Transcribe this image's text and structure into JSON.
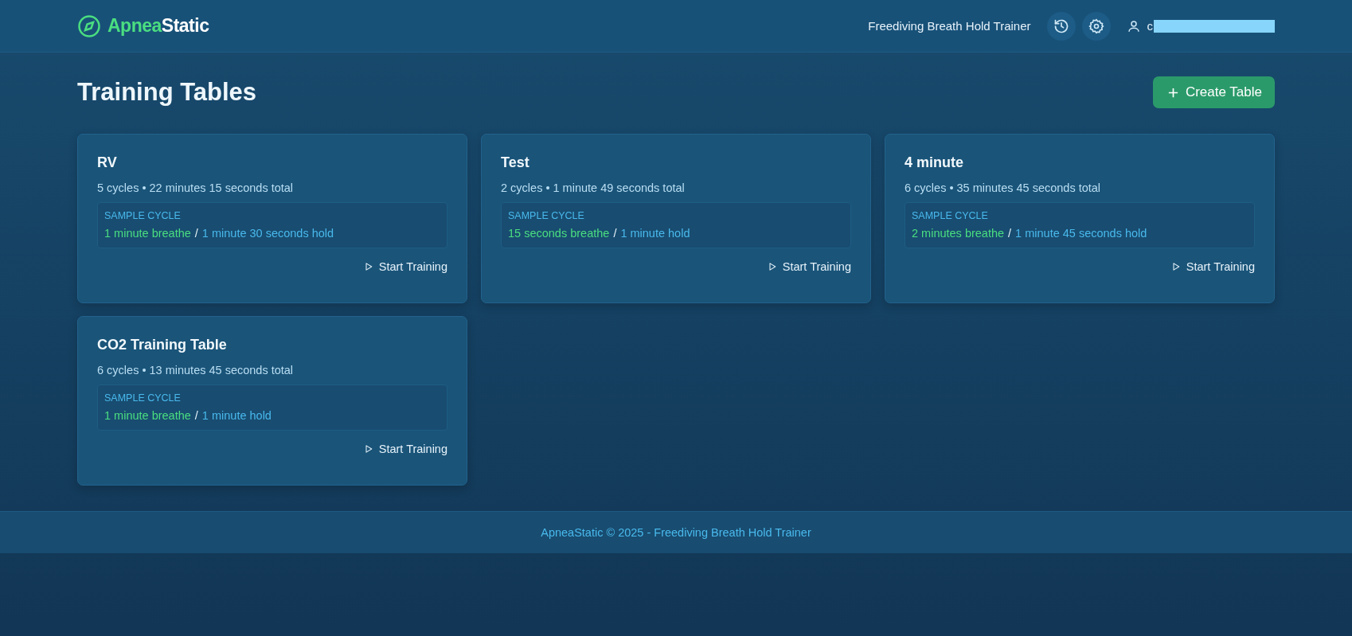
{
  "header": {
    "brand_accent": "Apnea",
    "brand_rest": "Static",
    "tagline": "Freediving Breath Hold Trainer",
    "user": "c"
  },
  "page": {
    "title": "Training Tables",
    "create_button": "Create Table"
  },
  "tables": [
    {
      "name": "RV",
      "summary": "5 cycles • 22 minutes 15 seconds total",
      "sample_label": "SAMPLE CYCLE",
      "breathe": "1 minute breathe",
      "separator": "/",
      "hold": "1 minute 30 seconds hold",
      "action": "Start Training"
    },
    {
      "name": "Test",
      "summary": "2 cycles • 1 minute 49 seconds total",
      "sample_label": "SAMPLE CYCLE",
      "breathe": "15 seconds breathe",
      "separator": "/",
      "hold": "1 minute hold",
      "action": "Start Training"
    },
    {
      "name": "4 minute",
      "summary": "6 cycles • 35 minutes 45 seconds total",
      "sample_label": "SAMPLE CYCLE",
      "breathe": "2 minutes breathe",
      "separator": "/",
      "hold": "1 minute 45 seconds hold",
      "action": "Start Training"
    },
    {
      "name": "CO2 Training Table",
      "summary": "6 cycles • 13 minutes 45 seconds total",
      "sample_label": "SAMPLE CYCLE",
      "breathe": "1 minute breathe",
      "separator": "/",
      "hold": "1 minute hold",
      "action": "Start Training"
    }
  ],
  "footer": "ApneaStatic © 2025 - Freediving Breath Hold Trainer"
}
